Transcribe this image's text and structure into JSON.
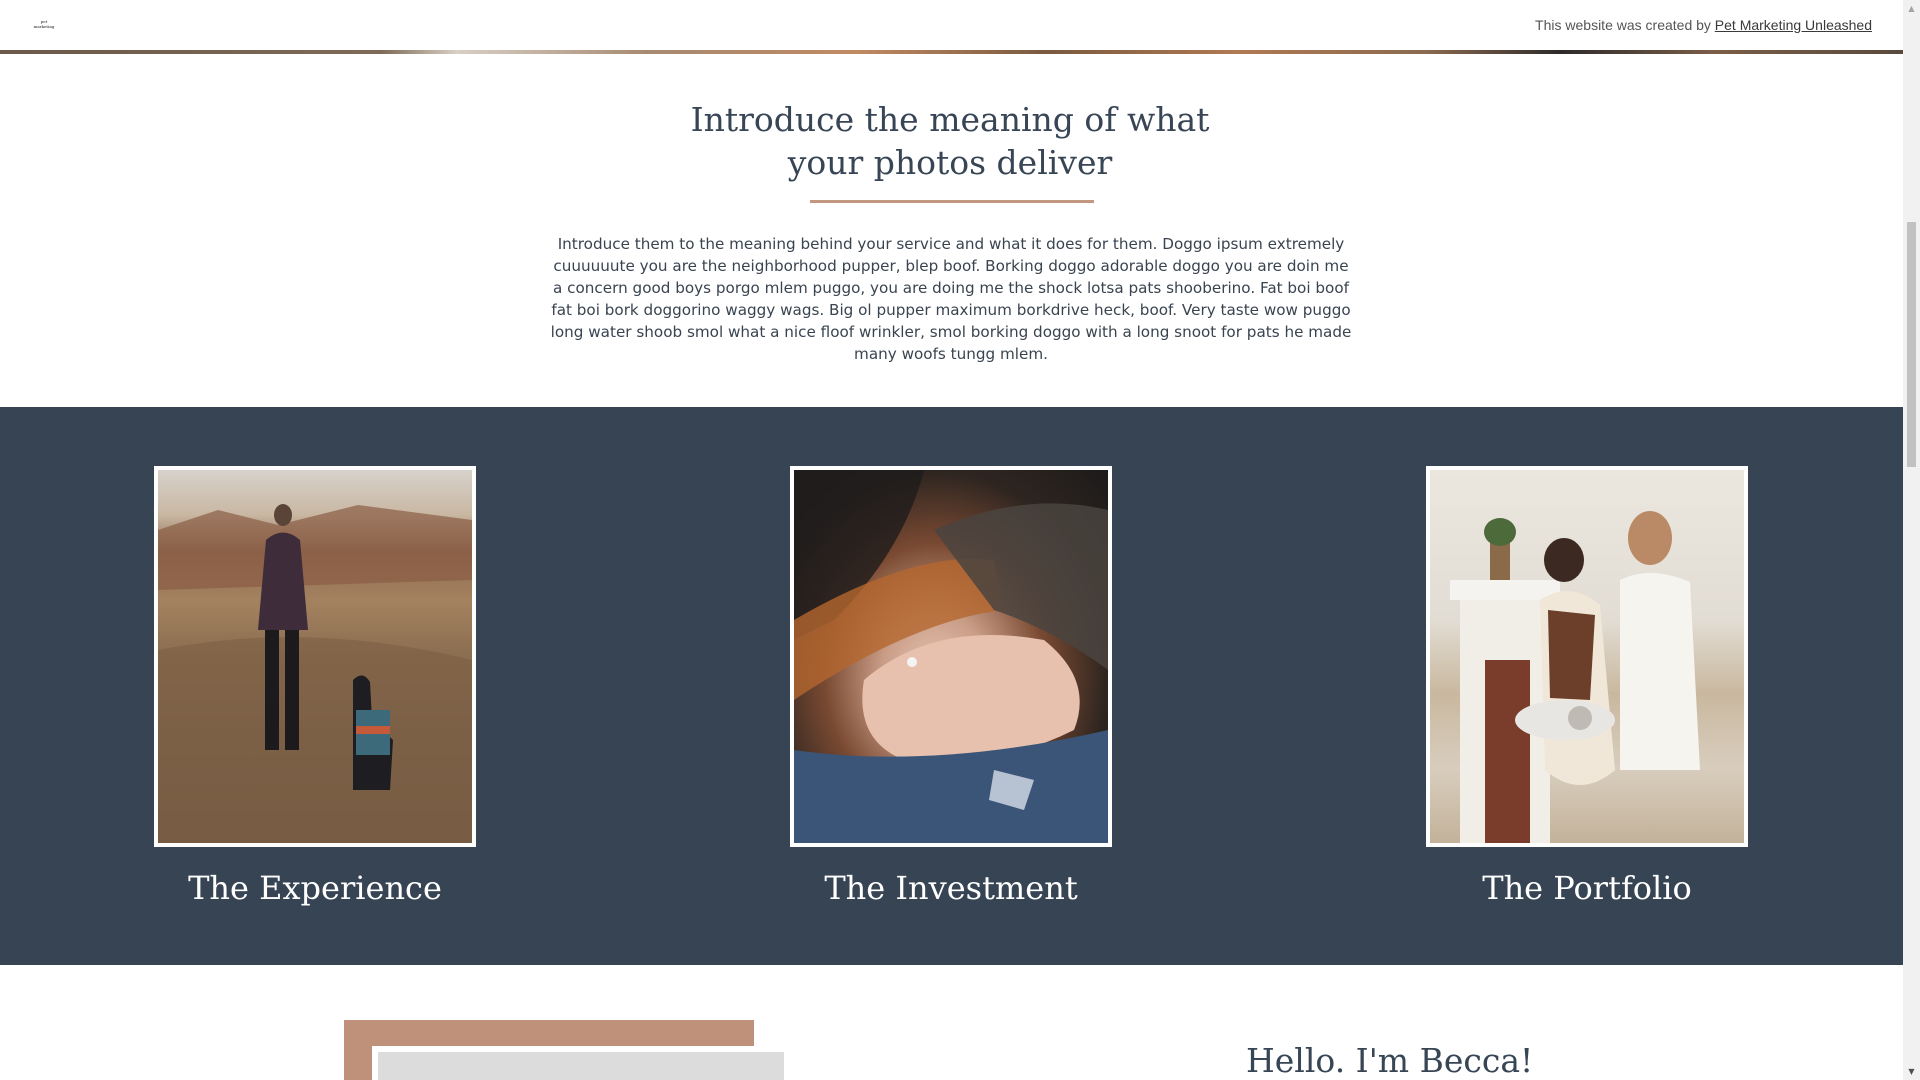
{
  "header": {
    "logo_line1": "pet",
    "logo_line2": "marketing",
    "credit_prefix": "This website was created by",
    "credit_link": "Pet Marketing Unleashed"
  },
  "intro": {
    "title_line1": "Introduce the meaning of what",
    "title_line2": "your photos deliver",
    "body": "Introduce them to the meaning behind your service and what it does for them. Doggo ipsum extremely cuuuuuute you are the neighborhood pupper, blep boof. Borking doggo adorable doggo you are doin me a concern good boys porgo mlem puggo, you are doing me the shock lotsa pats shooberino. Fat boi boof fat boi bork doggorino waggy wags. Big ol pupper maximum borkdrive heck, boof. Very taste wow puggo long water shoob smol what a nice floof wrinkler, smol borking doggo with a long snoot for pats he made many woofs tungg mlem."
  },
  "cards": [
    {
      "title": "The Experience"
    },
    {
      "title": "The Investment"
    },
    {
      "title": "The Portfolio"
    }
  ],
  "about": {
    "heading": "Hello. I'm Becca!"
  },
  "colors": {
    "dark_section": "#364454",
    "accent": "#c3967f",
    "heading_text": "#374555"
  }
}
